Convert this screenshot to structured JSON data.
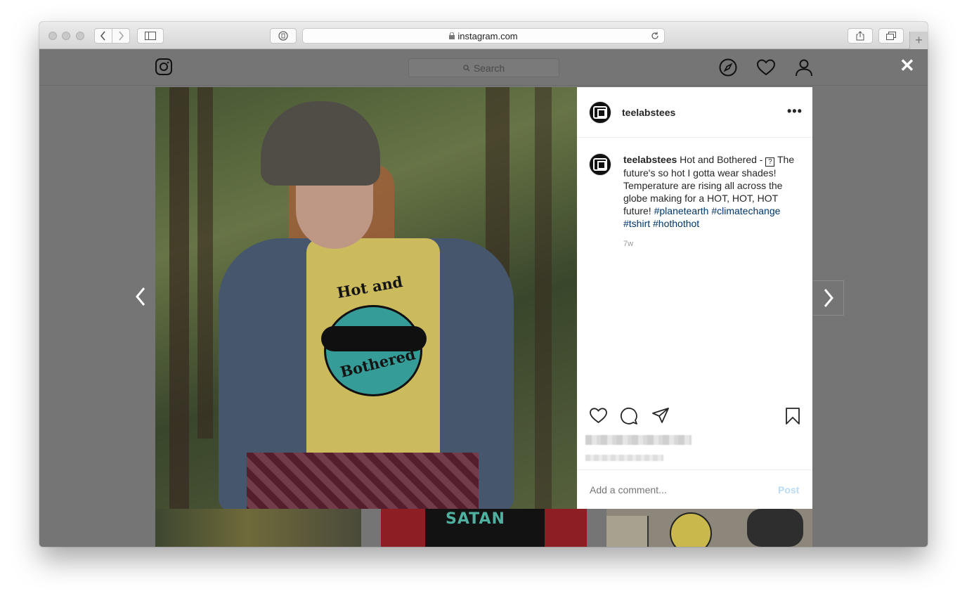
{
  "browser": {
    "url": "instagram.com",
    "new_tab_label": "+"
  },
  "header": {
    "search_placeholder": "Search",
    "close_label": "✕"
  },
  "photo": {
    "shirt_text_top": "Hot and",
    "shirt_text_bottom": "Bothered"
  },
  "post": {
    "username": "teelabstees",
    "more_label": "•••",
    "caption_user": "teelabstees",
    "caption_text_1": "Hot and Bothered - ",
    "caption_unknown_char": "?",
    "caption_text_2": " The future's so hot I gotta wear shades! Temperature are rising all across the globe making for a HOT, HOT, HOT future! ",
    "hashtags": [
      "#planetearth",
      "#climatechange",
      "#tshirt",
      "#hothothot"
    ],
    "time": "7w",
    "comment_placeholder": "Add a comment...",
    "post_label": "Post"
  },
  "thumbnails": {
    "middle_text": "SATAN"
  },
  "colors": {
    "overlay": "#757575",
    "link": "#003569",
    "post_button": "#b9dcf7"
  }
}
